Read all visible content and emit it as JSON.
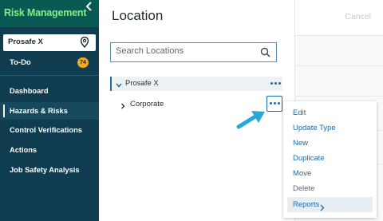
{
  "sidebar": {
    "title": "Risk Management",
    "site": "Prosafe X",
    "todo": {
      "label": "To-Do",
      "badge": "74"
    },
    "items": [
      {
        "label": "Dashboard",
        "active": false
      },
      {
        "label": "Hazards & Risks",
        "active": true
      },
      {
        "label": "Control Verifications",
        "active": false
      },
      {
        "label": "Actions",
        "active": false
      },
      {
        "label": "Job Safety Analysis",
        "active": false
      }
    ],
    "icons": {
      "collapse": "chevron-left-icon",
      "site": "location-pin-icon"
    }
  },
  "panel": {
    "title": "Location",
    "search_placeholder": "Search Locations",
    "tree": {
      "root": "Prosafe X",
      "child": "Corporate"
    }
  },
  "right": {
    "cancel_label": "Cancel"
  },
  "context_menu": {
    "items": [
      {
        "label": "Edit",
        "disabled": false
      },
      {
        "label": "Update Type",
        "disabled": false
      },
      {
        "label": "New",
        "disabled": false
      },
      {
        "label": "Duplicate",
        "disabled": false
      },
      {
        "label": "Move",
        "disabled": false
      },
      {
        "label": "Delete",
        "disabled": true
      },
      {
        "label": "Reports",
        "disabled": false,
        "submenu": true
      }
    ]
  },
  "colors": {
    "sidebar_bg": "#0f3d4f",
    "header_bg": "#0a5a54",
    "title_green": "#7ef27e",
    "accent_blue": "#1a6aa8",
    "badge_orange": "#f4a820",
    "callout_arrow": "#29a8d8"
  }
}
